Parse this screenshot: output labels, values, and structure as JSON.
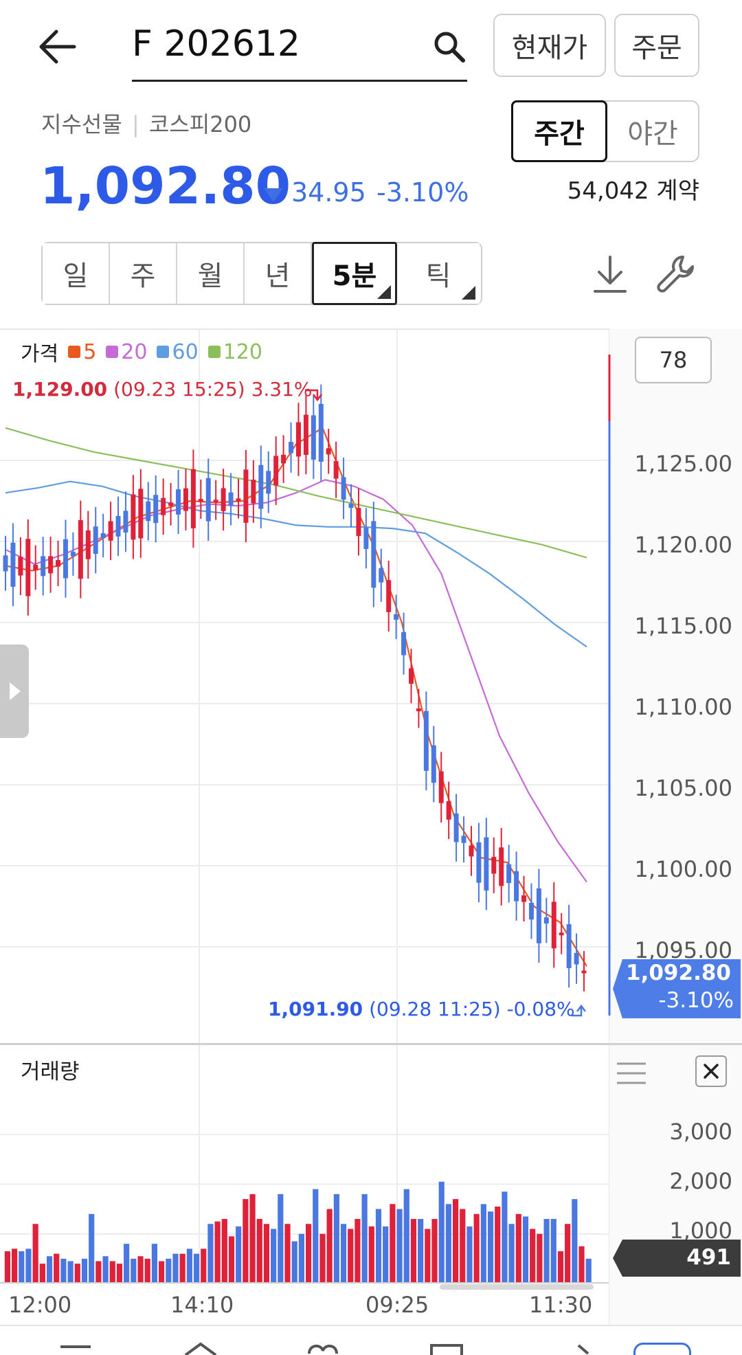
{
  "header": {
    "symbol": "F 202612",
    "current_price_btn": "현재가",
    "order_btn": "주문"
  },
  "instrument": {
    "category": "지수선물",
    "underlying": "코스피200",
    "session_day": "주간",
    "session_night": "야간",
    "price": "1,092.80",
    "change": "34.95",
    "change_pct": "-3.10%",
    "volume_contracts": "54,042 계약"
  },
  "period_tabs": [
    "일",
    "주",
    "월",
    "년",
    "5분",
    "틱"
  ],
  "active_tab": "5분",
  "chart": {
    "legend_title": "가격",
    "ma_legend": [
      {
        "label": "5",
        "color": "#e8581f"
      },
      {
        "label": "20",
        "color": "#c56ad6"
      },
      {
        "label": "60",
        "color": "#5d9de0"
      },
      {
        "label": "120",
        "color": "#8cbf5b"
      }
    ],
    "high_price": "1,129.00",
    "high_detail": "(09.23 15:25) 3.31%",
    "low_price": "1,091.90",
    "low_detail": "(09.28 11:25) -0.08%",
    "count_box": "78",
    "y_ticks": [
      "1,125.00",
      "1,120.00",
      "1,115.00",
      "1,110.00",
      "1,105.00",
      "1,100.00",
      "1,095.00"
    ],
    "current_tag_price": "1,092.80",
    "current_tag_pct": "-3.10%",
    "up_color": "#e0213a",
    "down_color": "#4a78e0"
  },
  "volume": {
    "title": "거래량",
    "y_ticks": [
      "3,000",
      "2,000",
      "1,000"
    ],
    "current_tag": "491"
  },
  "x_axis": [
    "12:00",
    "14:10",
    "09:25",
    "11:30"
  ],
  "chart_data": {
    "type": "bar",
    "title": "",
    "xlabel": "",
    "ylabel": "",
    "x": [
      "12:00",
      "14:10",
      "09:25",
      "11:30"
    ],
    "price_ylim": [
      1090,
      1131
    ],
    "volume_ylim": [
      0,
      3500
    ],
    "series": [
      {
        "name": "5",
        "values": [
          1118.5,
          1118.2,
          1118.5,
          1119.5,
          1120.5,
          1121.5,
          1122.0,
          1122.5,
          1122.4,
          1122.5,
          1123.5,
          1126.0,
          1127.0,
          1123.0,
          1119.5,
          1115.0,
          1108.0,
          1103.0,
          1100.5,
          1100.2,
          1097.5,
          1096.5,
          1093.8
        ]
      },
      {
        "name": "20",
        "values": [
          1119.5,
          1118.6,
          1119.2,
          1120.0,
          1120.8,
          1121.6,
          1122.0,
          1122.3,
          1122.2,
          1122.4,
          1123.0,
          1123.8,
          1123.4,
          1122.6,
          1121.0,
          1118.0,
          1113.0,
          1108.0,
          1104.5,
          1101.5,
          1099.0
        ]
      },
      {
        "name": "60",
        "values": [
          1123.0,
          1123.3,
          1123.7,
          1123.4,
          1122.8,
          1122.4,
          1121.9,
          1121.7,
          1121.4,
          1121.0,
          1120.9,
          1120.9,
          1120.8,
          1120.5,
          1119.3,
          1118.0,
          1116.5,
          1114.9,
          1113.5
        ]
      },
      {
        "name": "120",
        "values": [
          1127.0,
          1126.2,
          1125.5,
          1125.0,
          1124.5,
          1124.0,
          1123.5,
          1122.8,
          1122.2,
          1121.6,
          1121.0,
          1120.4,
          1119.8,
          1119.0
        ]
      },
      {
        "name": "거래량",
        "values": [
          650,
          700,
          650,
          700,
          1200,
          400,
          550,
          600,
          500,
          450,
          400,
          500,
          1400,
          450,
          550,
          450,
          400,
          800,
          500,
          550,
          500,
          800,
          450,
          500,
          600,
          600,
          700,
          600,
          700,
          1200,
          1250,
          1300,
          950,
          1150,
          1700,
          1800,
          1300,
          1200,
          1100,
          1800,
          1200,
          850,
          1000,
          1200,
          1900,
          1000,
          1500,
          1800,
          1200,
          1100,
          1300,
          1800,
          1150,
          1500,
          1150,
          1600,
          1500,
          1900,
          1300,
          1300,
          1100,
          1300,
          2050,
          1600,
          1700,
          1500,
          1150,
          1400,
          1600,
          1450,
          1550,
          1850,
          1200,
          1400,
          1350,
          1100,
          1000,
          1300,
          1300,
          650,
          1200,
          1700,
          750,
          500
        ]
      }
    ]
  }
}
